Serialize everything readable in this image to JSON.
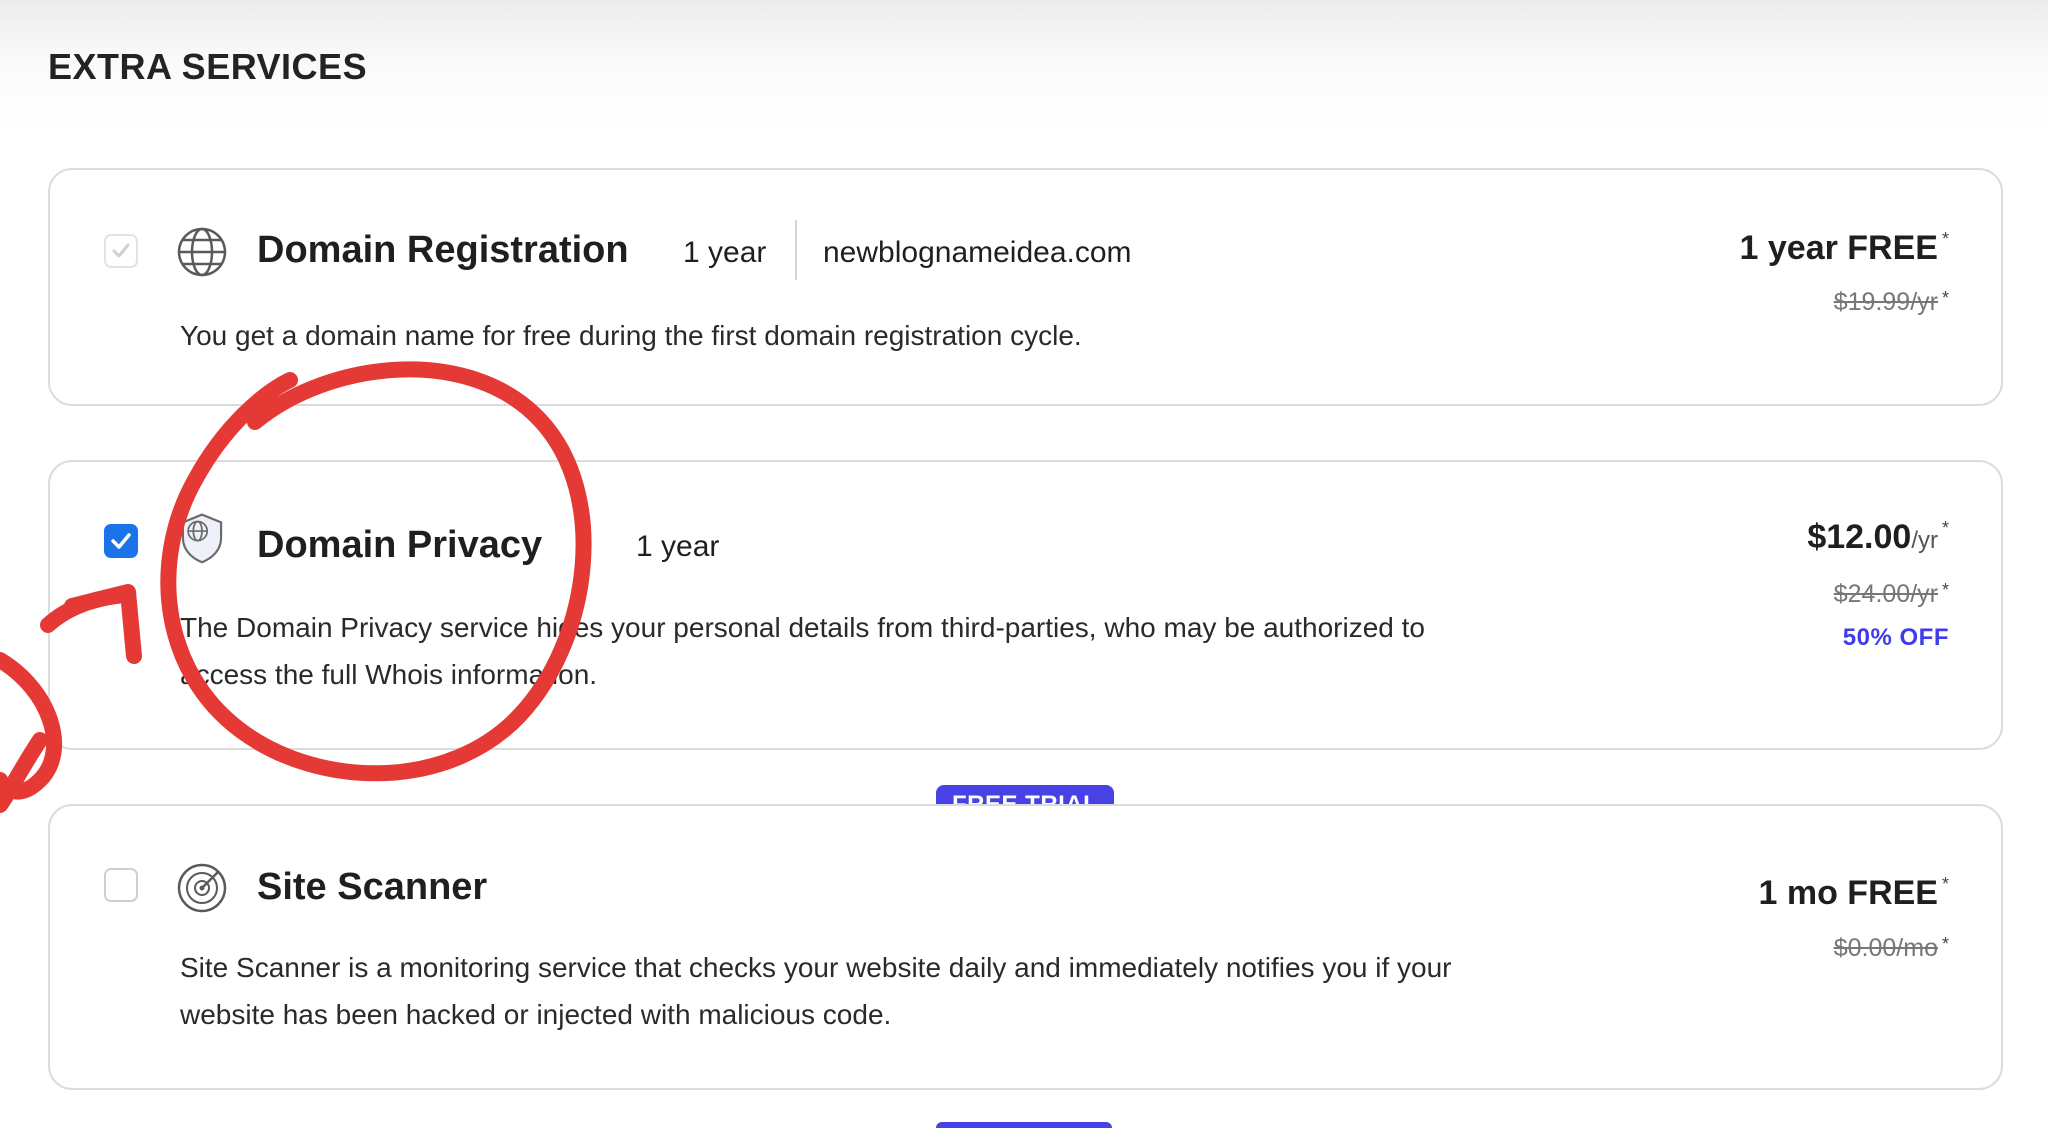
{
  "section": {
    "title": "EXTRA SERVICES"
  },
  "services": [
    {
      "name": "Domain Registration",
      "period": "1 year",
      "domain": "newblognameidea.com",
      "description": "You get a domain name for free during the first domain registration cycle.",
      "price": "1 year FREE",
      "price_unit": "",
      "old_price": "$19.99/yr",
      "discount": "",
      "checked": true,
      "disabled": true,
      "icon": "globe-icon"
    },
    {
      "name": "Domain Privacy",
      "period": "1 year",
      "description": "The Domain Privacy service hides your personal details from third-parties, who may be authorized to access the full Whois information.",
      "price": "$12.00",
      "price_unit": "/yr",
      "old_price": "$24.00/yr",
      "discount": "50% OFF",
      "checked": true,
      "disabled": false,
      "icon": "shield-globe-icon"
    },
    {
      "badge": "FREE TRIAL",
      "name": "Site Scanner",
      "description": "Site Scanner is a monitoring service that checks your website daily and immediately notifies you if your website has been hacked or injected with malicious code.",
      "price": "1 mo FREE",
      "price_unit": "",
      "old_price": "$0.00/mo",
      "discount": "",
      "checked": false,
      "disabled": false,
      "icon": "radar-scan-icon"
    }
  ],
  "asterisk": "*",
  "colors": {
    "accent": "#4741e6",
    "checkbox_blue": "#1a73e8",
    "annotation_red": "#e53935"
  }
}
